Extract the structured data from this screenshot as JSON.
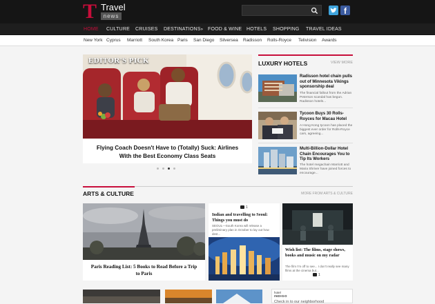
{
  "brand": {
    "logo_letter": "T",
    "name": "Travel",
    "tagline": "news",
    "accent": "#c70d3a"
  },
  "header": {
    "search_placeholder": ""
  },
  "main_nav": [
    "HOME",
    "CULTURE",
    "CRUISES",
    "DESTINATIONS",
    "FOOD & WINE",
    "HOTELS",
    "SHOPPING",
    "TRAVEL IDEAS"
  ],
  "main_nav_destinations_suffix": "»",
  "sub_nav": [
    "New York",
    "Cyprus",
    "Marriott",
    "South Korea",
    "Paris",
    "San Diego",
    "Silversea",
    "Radisson",
    "Rolls-Royce",
    "Telivision",
    "Awards"
  ],
  "editors_pick": {
    "label": "EDITOR'S PICK",
    "title_line1": "Flying Coach Doesn't Have to (Totally) Suck: Airlines",
    "title_line2": "With the Best Economy Class Seats",
    "active_slide": 3
  },
  "luxury": {
    "heading": "LUXURY HOTELS",
    "view_more": "VIEW MORE",
    "items": [
      {
        "title": "Radisson hotel chain pulls out of Minnesota Vikings sponsorship deal",
        "text": "The financial fallout from the Adrian Peterson scandal has begun. Radisson hotels..."
      },
      {
        "title": "Tycoon Buys 30 Rolls-Royces for Macau Hotel",
        "text": "A Hong Kong tycoon has placed the biggest ever order for Rolls-Royce cars, agreeing..."
      },
      {
        "title": "Multi-Billion-Dollar Hotel Chain Encourages You to Tip Its Workers",
        "text": "The hotel megachain Marriott and Maria Shriver have joined forces to encourage..."
      }
    ]
  },
  "arts": {
    "heading": "ARTS & CULTURE",
    "more": "MORE FROM ARTS & CULTURE",
    "paris": {
      "title_line1": "Paris Reading List: 5 Books to Read Before a Trip",
      "title_line2": "to Paris"
    },
    "seoul": {
      "title": "Indian and travelling to Seoul: Things you must do",
      "text": "SEOUL—South Korea will release a preliminary plan in October to lay out how dest...",
      "comments": "1"
    },
    "wish": {
      "title": "Wish list: The films, stage shows, books and music on my radar",
      "text": "The film I'm off to see... I don't really see many films at the cinema but...",
      "comments": "1"
    }
  },
  "promo": {
    "logo_top": "hotel",
    "logo_bottom": "INDIGO",
    "text": "Check in to our neighborhood"
  }
}
